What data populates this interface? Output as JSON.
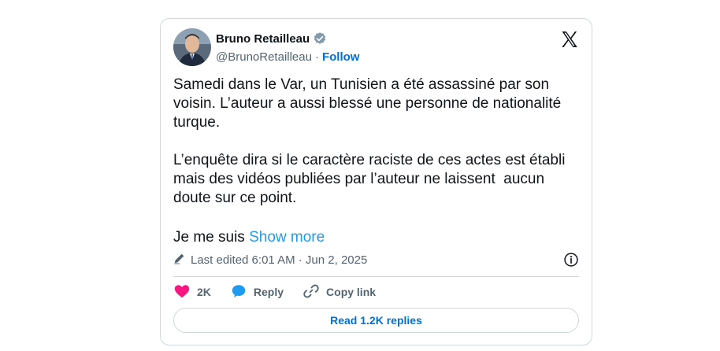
{
  "author": {
    "name": "Bruno Retailleau",
    "handle": "@BrunoRetailleau",
    "separator": "·",
    "follow_label": "Follow",
    "verified_icon": "verified-badge-icon",
    "avatar_icon": "avatar"
  },
  "brand": {
    "logo_icon": "x-logo-icon",
    "text_color": "#0f1419"
  },
  "tweet": {
    "text": "Samedi dans le Var, un Tunisien a été assassiné par son voisin. L’auteur a aussi blessé une personne de nationalité turque.\n\nL’enquête dira si le caractère raciste de ces actes est établi mais des vidéos publiées par l’auteur ne laissent  aucun doute sur ce point.",
    "truncated_text": "Je me suis",
    "show_more_label": "Show more"
  },
  "meta": {
    "edited_icon": "pencil-icon",
    "edited_text": "Last edited 6:01 AM · Jun 2, 2025",
    "info_icon": "info-icon"
  },
  "actions": {
    "like_icon": "heart-icon",
    "like_count": "2K",
    "reply_icon": "speech-bubble-icon",
    "reply_label": "Reply",
    "copy_icon": "link-icon",
    "copy_label": "Copy link"
  },
  "footer": {
    "read_replies_label": "Read 1.2K replies"
  },
  "colors": {
    "like": "#f91880",
    "reply": "#1d9bf0",
    "link": "#006fd6",
    "show_more": "#1d9bf0",
    "secondary_text": "#536471",
    "border": "#cfd9de"
  }
}
